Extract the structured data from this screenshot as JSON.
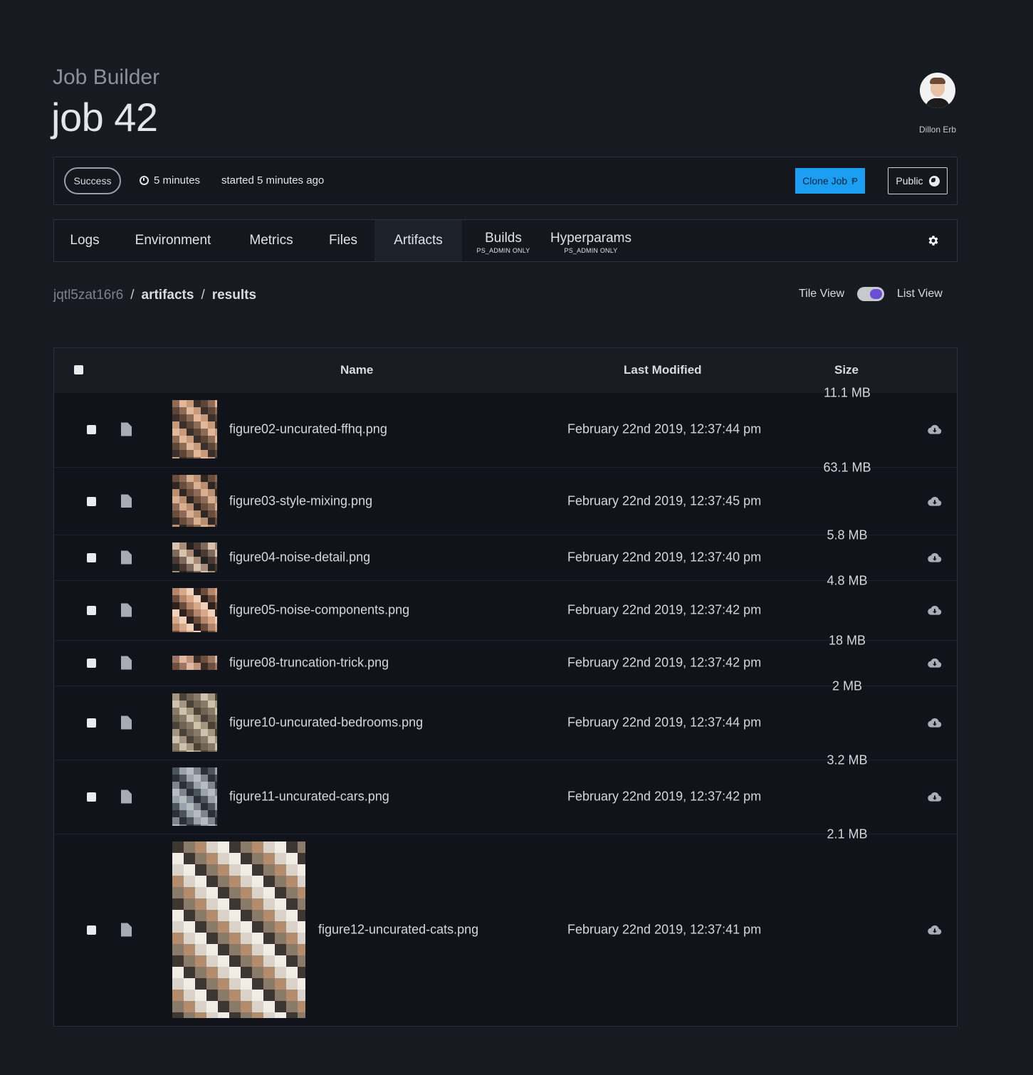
{
  "header": {
    "subtitle": "Job Builder",
    "title": "job 42"
  },
  "user": {
    "name": "Dillon Erb"
  },
  "status": {
    "badge": "Success",
    "duration": "5 minutes",
    "started": "started 5 minutes ago",
    "clone_label": "Clone Job",
    "public_label": "Public"
  },
  "tabs": [
    {
      "label": "Logs"
    },
    {
      "label": "Environment"
    },
    {
      "label": "Metrics"
    },
    {
      "label": "Files"
    },
    {
      "label": "Artifacts",
      "active": true
    },
    {
      "label": "Builds",
      "note": "PS_ADMIN ONLY"
    },
    {
      "label": "Hyperparams",
      "note": "PS_ADMIN ONLY"
    }
  ],
  "breadcrumb": {
    "root": "jqtl5zat16r6",
    "sep": "/",
    "level1": "artifacts",
    "level2": "results"
  },
  "view_toggle": {
    "tile": "Tile View",
    "list": "List View",
    "mode": "List View"
  },
  "table": {
    "headers": {
      "name": "Name",
      "modified": "Last Modified",
      "size": "Size"
    },
    "rows": [
      {
        "name": "figure02-uncurated-ffhq.png",
        "modified": "February 22nd 2019, 12:37:44 pm",
        "size": "11.1 MB"
      },
      {
        "name": "figure03-style-mixing.png",
        "modified": "February 22nd 2019, 12:37:45 pm",
        "size": "63.1 MB"
      },
      {
        "name": "figure04-noise-detail.png",
        "modified": "February 22nd 2019, 12:37:40 pm",
        "size": "5.8 MB"
      },
      {
        "name": "figure05-noise-components.png",
        "modified": "February 22nd 2019, 12:37:42 pm",
        "size": "4.8 MB"
      },
      {
        "name": "figure08-truncation-trick.png",
        "modified": "February 22nd 2019, 12:37:42 pm",
        "size": "18 MB"
      },
      {
        "name": "figure10-uncurated-bedrooms.png",
        "modified": "February 22nd 2019, 12:37:44 pm",
        "size": "2 MB"
      },
      {
        "name": "figure11-uncurated-cars.png",
        "modified": "February 22nd 2019, 12:37:42 pm",
        "size": "3.2 MB"
      },
      {
        "name": "figure12-uncurated-cats.png",
        "modified": "February 22nd 2019, 12:37:41 pm",
        "size": "2.1 MB"
      }
    ]
  },
  "colors": {
    "accent": "#1c9ff2",
    "toggle": "#6c4ed4",
    "background": "#171a21"
  },
  "icons": [
    "clock-icon",
    "key-icon",
    "globe-icon",
    "gear-icon",
    "file-icon",
    "cloud-download-icon"
  ]
}
